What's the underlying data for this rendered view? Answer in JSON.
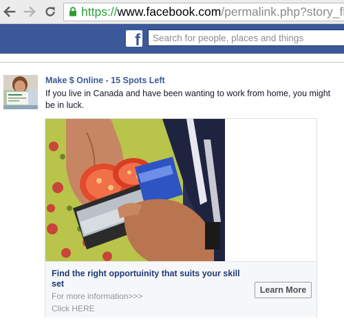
{
  "browser": {
    "url_scheme": "https://",
    "url_host": "www.facebook.com",
    "url_path": "/permalink.php?story_fbid",
    "icons": [
      "back-arrow-icon",
      "forward-arrow-icon",
      "reload-icon",
      "lock-icon"
    ]
  },
  "header": {
    "logo_letter": "f",
    "search_placeholder": "Search for people, places and things"
  },
  "post": {
    "headline": "Make $ Online - 15 Spots Left",
    "body": "If you live in Canada and have been wanting to work from home, you might be in luck.",
    "card": {
      "title": "Find the right opportuinity that suits your skill set",
      "description": "For more information>>>",
      "cta_text": "Click HERE",
      "button_label": "Learn More"
    }
  },
  "colors": {
    "facebook_blue": "#3b5998",
    "link_blue": "#3b5998",
    "secure_green": "#2e9b3a"
  }
}
